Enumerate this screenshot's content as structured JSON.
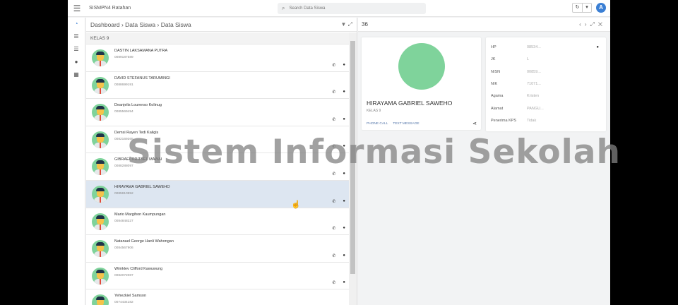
{
  "header": {
    "app_title": "SISMPN4 Ratahan",
    "search_placeholder": "Search Data Siswa",
    "avatar_letter": "A"
  },
  "breadcrumb": [
    "Dashboard",
    "Data Siswa",
    "Data Siswa"
  ],
  "list": {
    "group": "KELAS 9",
    "items": [
      {
        "name": "DASTIN LAKSAMANA PUTRA",
        "nisn": "0089187589"
      },
      {
        "name": "DAVID STEFANUS TARUMINGI",
        "nisn": "0088699191"
      },
      {
        "name": "Deanjelis Lourenso Kolinug",
        "nisn": "0085569494"
      },
      {
        "name": "Demsi Rayen Tedi Kaligis",
        "nisn": "0082169265"
      },
      {
        "name": "GIBRAEL FRITSEL MAWAI",
        "nisn": "0088288097"
      },
      {
        "name": "HIRAYAMA GABRIEL SAWEHO",
        "nisn": "0085910952"
      },
      {
        "name": "Mario Margihon Kaumpungan",
        "nisn": "0084848227"
      },
      {
        "name": "Natanael George Hanli Wahongan",
        "nisn": "0084567906"
      },
      {
        "name": "Wimklev Clifford Kawuwung",
        "nisn": "0082072087"
      },
      {
        "name": "Yehezkiel Samson",
        "nisn": "0074434182"
      }
    ]
  },
  "detail": {
    "id": "36",
    "name": "HIRAYAMA GABRIEL SAWEHO",
    "kelas": "KELAS 9",
    "phone_call": "PHONE CALL",
    "text_message": "TEXT MESSAGE",
    "fields": [
      {
        "label": "HP",
        "value": "08534..."
      },
      {
        "label": "JK",
        "value": "L"
      },
      {
        "label": "NISN",
        "value": "00859..."
      },
      {
        "label": "NIK",
        "value": "71071..."
      },
      {
        "label": "Agama",
        "value": "Kristen"
      },
      {
        "label": "Alamat",
        "value": "PANGU..."
      },
      {
        "label": "Penerima KPS",
        "value": "Tidak"
      }
    ]
  },
  "watermark": "Sistem Informasi Sekolah"
}
